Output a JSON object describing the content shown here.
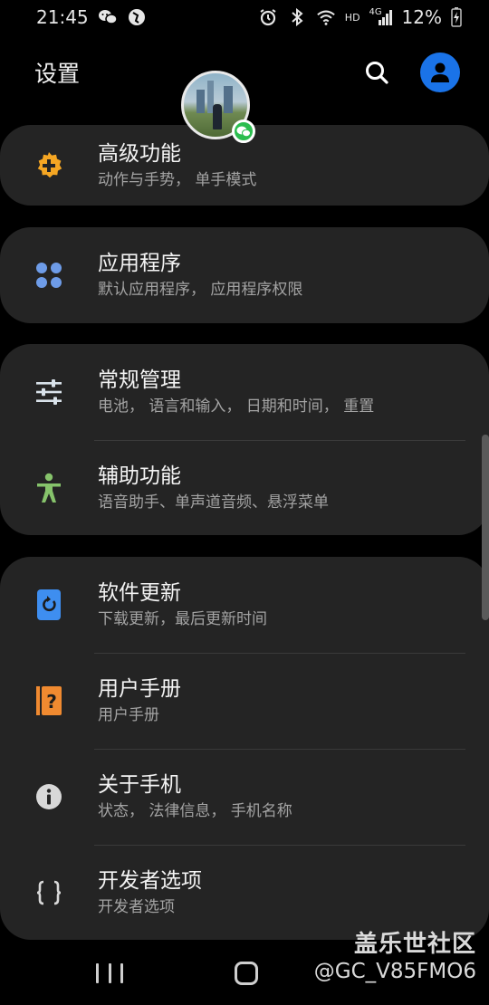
{
  "status_bar": {
    "time": "21:45",
    "network": "HD",
    "signal_type": "4G",
    "battery": "12%",
    "left_icons": [
      "wechat-icon",
      "browser-icon"
    ],
    "right_icons": [
      "alarm-icon",
      "bluetooth-icon",
      "wifi-icon",
      "signal-icon",
      "battery-icon"
    ]
  },
  "header": {
    "title": "设置",
    "search_icon": "search-icon",
    "account_icon": "account-icon"
  },
  "floating_avatar": {
    "badge_icon": "wechat-badge-icon"
  },
  "sections": [
    {
      "items": [
        {
          "title": "高级功能",
          "subtitle": "动作与手势， 单手模式",
          "icon": "advanced-features-icon",
          "icon_color": "#f5a623"
        }
      ]
    },
    {
      "items": [
        {
          "title": "应用程序",
          "subtitle": "默认应用程序， 应用程序权限",
          "icon": "apps-icon",
          "icon_color": "#6e9ce8"
        }
      ]
    },
    {
      "items": [
        {
          "title": "常规管理",
          "subtitle": "电池， 语言和输入， 日期和时间， 重置",
          "icon": "sliders-icon",
          "icon_color": "#d9e2ea"
        },
        {
          "title": "辅助功能",
          "subtitle": "语音助手、单声道音频、悬浮菜单",
          "icon": "accessibility-icon",
          "icon_color": "#86c36b"
        }
      ]
    },
    {
      "items": [
        {
          "title": "软件更新",
          "subtitle": "下载更新，最后更新时间",
          "icon": "software-update-icon",
          "icon_color": "#3e8ef0"
        },
        {
          "title": "用户手册",
          "subtitle": "用户手册",
          "icon": "user-manual-icon",
          "icon_color": "#f08a30"
        },
        {
          "title": "关于手机",
          "subtitle": "状态， 法律信息， 手机名称",
          "icon": "info-icon",
          "icon_color": "#d8d8d8"
        },
        {
          "title": "开发者选项",
          "subtitle": "开发者选项",
          "icon": "developer-options-icon",
          "icon_color": "#d8d8d8"
        }
      ]
    }
  ],
  "watermark": {
    "brand": "盖乐世社区",
    "user": "@GC_V85FMO6"
  },
  "colors": {
    "background": "#000000",
    "card": "#242424",
    "accent_blue": "#1a73e8",
    "wechat_green": "#2bbd4e"
  }
}
